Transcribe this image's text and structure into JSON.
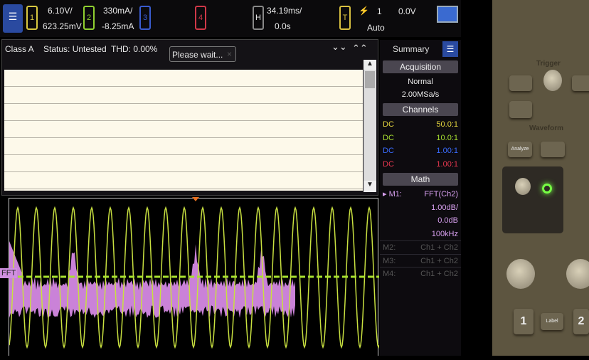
{
  "topbar": {
    "ch1": {
      "label": "1",
      "scale": "6.10V/",
      "offset": "623.25mV"
    },
    "ch2": {
      "label": "2",
      "scale": "330mA/",
      "offset": "-8.25mA"
    },
    "ch3": {
      "label": "3"
    },
    "ch4": {
      "label": "4"
    },
    "horizontal": {
      "label": "H",
      "scale": "34.19ms/",
      "delay": "0.0s"
    },
    "trigger": {
      "label": "T",
      "source": "1",
      "level": "0.0V",
      "mode": "Auto"
    }
  },
  "results": {
    "class": "Class A",
    "status": "Status: Untested",
    "thd": "THD: 0.00%",
    "popup": "Please wait...",
    "popup_close": "×",
    "collapse": "⌄⌄",
    "expand": "⌃⌃"
  },
  "waveform": {
    "fft_label": "FFT",
    "cycles": 20
  },
  "sidebar": {
    "title": "Summary",
    "acquisition_header": "Acquisition",
    "acq_mode": "Normal",
    "sample_rate": "2.00MSa/s",
    "channels_header": "Channels",
    "channels": [
      {
        "coupling": "DC",
        "probe": "50.0:1",
        "color": "#e8d840"
      },
      {
        "coupling": "DC",
        "probe": "10.0:1",
        "color": "#a8e030"
      },
      {
        "coupling": "DC",
        "probe": "1.00:1",
        "color": "#3a6cff"
      },
      {
        "coupling": "DC",
        "probe": "1.00:1",
        "color": "#e83850"
      }
    ],
    "math_header": "Math",
    "m1_label": "M1:",
    "m1_func": "FFT(Ch2)",
    "m1_scale": "1.00dB/",
    "m1_offset": "0.0dB",
    "m1_span": "100kHz",
    "others": [
      {
        "label": "M2:",
        "func": "Ch1 + Ch2"
      },
      {
        "label": "M3:",
        "func": "Ch1 + Ch2"
      },
      {
        "label": "M4:",
        "func": "Ch1 + Ch2"
      }
    ]
  },
  "front_panel": {
    "trigger": "Trigger",
    "waveform": "Waveform",
    "analyze": "Analyze",
    "label": "Label",
    "ch1": "1",
    "ch2": "2"
  }
}
